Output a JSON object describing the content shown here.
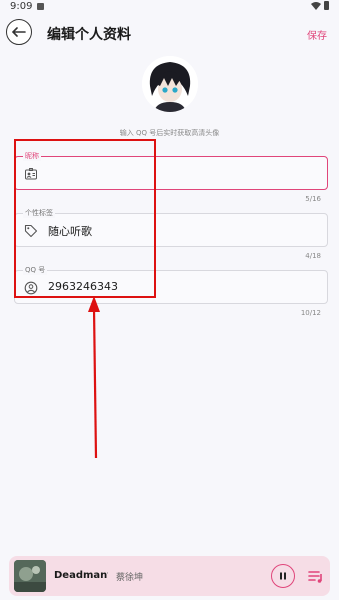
{
  "status": {
    "time": "9:09"
  },
  "header": {
    "title": "编辑个人资料",
    "save_label": "保存"
  },
  "avatar_hint": "输入 QQ 号后实时获取高清头像",
  "fields": [
    {
      "label": "昵称",
      "value": "",
      "counter": "5/16",
      "icon": "id-card-icon",
      "focused": true
    },
    {
      "label": "个性标签",
      "value": "随心听歌",
      "counter": "4/18",
      "icon": "tag-icon",
      "focused": false
    },
    {
      "label": "QQ 号",
      "value": "2963246343",
      "counter": "10/12",
      "icon": "user-circle-icon",
      "focused": false
    }
  ],
  "player": {
    "song": "Deadman",
    "separator": "·",
    "artist": "蔡徐坤"
  },
  "colors": {
    "accent": "#e0457a",
    "annotation": "#d11111"
  }
}
